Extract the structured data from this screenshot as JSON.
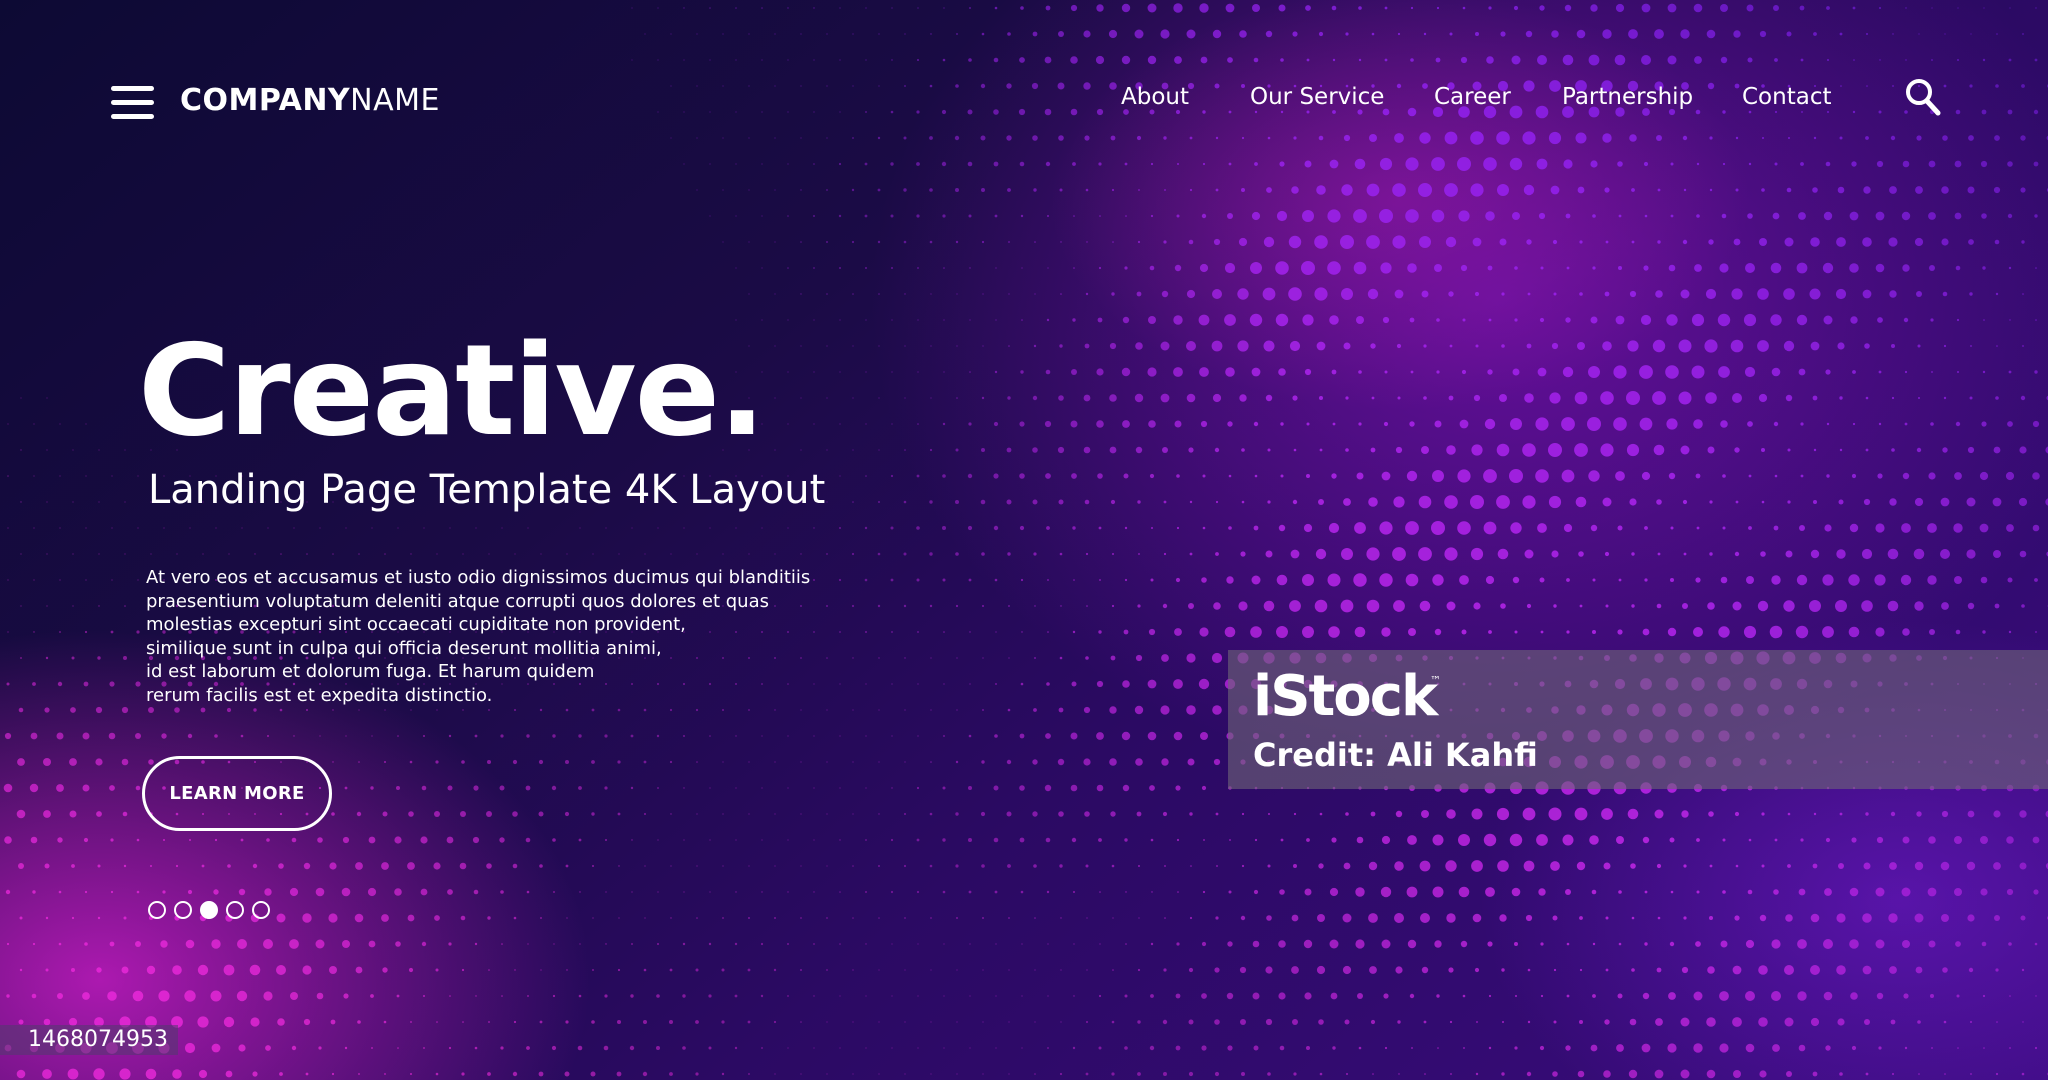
{
  "header": {
    "brand_bold": "COMPANY",
    "brand_light": "NAME",
    "nav": [
      "About",
      "Our Service",
      "Career",
      "Partnership",
      "Contact"
    ],
    "menu_icon": "hamburger-menu-icon",
    "search_icon": "search-icon"
  },
  "hero": {
    "title": "Creative.",
    "subtitle": "Landing Page Template 4K Layout",
    "body_lines": [
      "At vero eos et accusamus et iusto odio dignissimos ducimus qui blanditiis",
      "praesentium voluptatum deleniti atque corrupti quos dolores et quas",
      "molestias excepturi sint occaecati cupiditate non provident,",
      "similique sunt in culpa qui officia deserunt mollitia animi,",
      "id est laborum et dolorum fuga. Et harum quidem",
      "rerum facilis est et expedita distinctio."
    ],
    "cta_label": "LEARN MORE"
  },
  "pager": {
    "count": 5,
    "active_index": 2
  },
  "watermark": {
    "brand": "iStock",
    "trademark": "™",
    "credit": "Credit: Ali Kahfi"
  },
  "image_id": "1468074953",
  "colors": {
    "background_dark": "#140a38",
    "accent_magenta": "#e020d8",
    "accent_purple": "#7a1fe8",
    "text": "#ffffff"
  }
}
